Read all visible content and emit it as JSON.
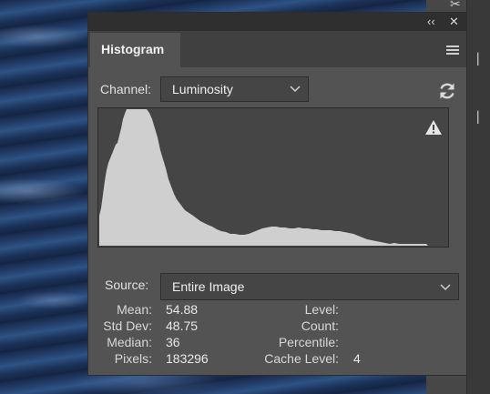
{
  "panel": {
    "tab_label": "Histogram",
    "collapse_label": "‹‹",
    "close_label": "✕"
  },
  "channel": {
    "label": "Channel:",
    "value": "Luminosity"
  },
  "source": {
    "label": "Source:",
    "value": "Entire Image"
  },
  "stats": {
    "mean_label": "Mean:",
    "mean": "54.88",
    "std_label": "Std Dev:",
    "std": "48.75",
    "median_label": "Median:",
    "median": "36",
    "pixels_label": "Pixels:",
    "pixels": "183296",
    "level_label": "Level:",
    "count_label": "Count:",
    "percentile_label": "Percentile:",
    "cache_label": "Cache Level:",
    "cache": "4"
  },
  "histogram_color": "#cfcfcf",
  "icons": {
    "refresh": "refresh-icon",
    "warning": "warning-icon",
    "menu": "panel-menu-icon",
    "chevron": "chevron-down-icon"
  }
}
